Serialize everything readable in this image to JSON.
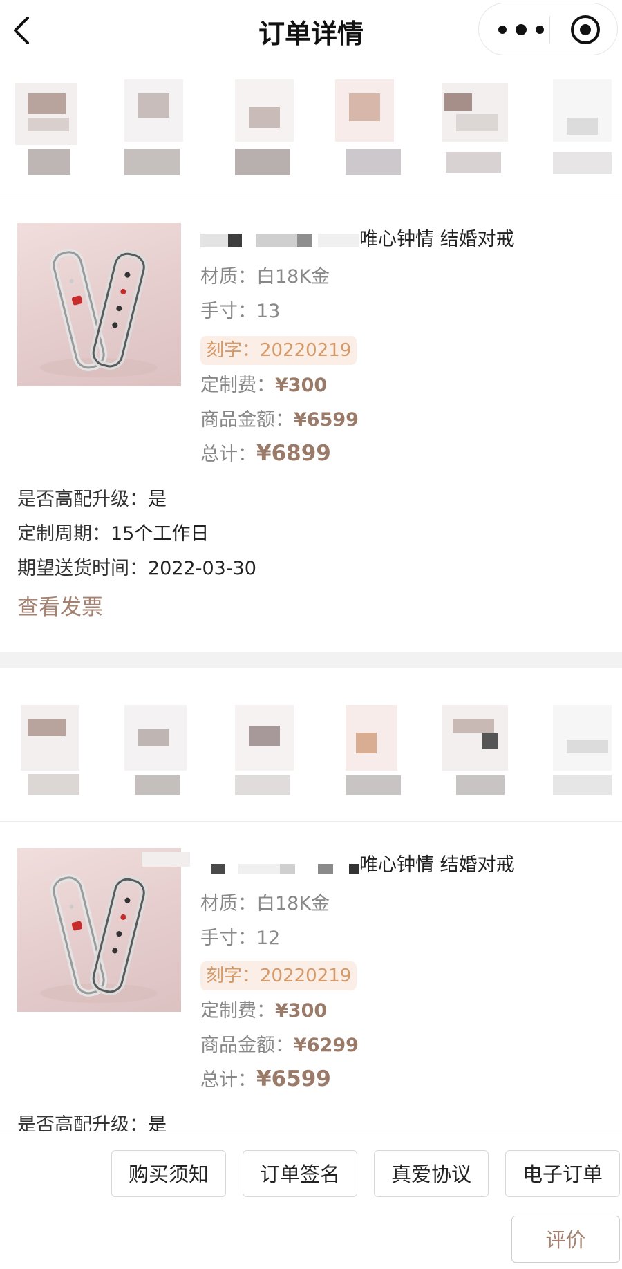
{
  "header": {
    "title": "订单详情"
  },
  "orders": [
    {
      "product_name": "唯心钟情 结婚对戒",
      "material_label": "材质：",
      "material": "白18K金",
      "size_label": "手寸：",
      "size": "13",
      "engrave_label": "刻字：",
      "engrave": "20220219",
      "custom_fee_label": "定制费：",
      "custom_fee": "¥300",
      "goods_amount_label": "商品金额：",
      "goods_amount": "¥6599",
      "total_label": "总计：",
      "total": "¥6899",
      "upgrade_label": "是否高配升级：",
      "upgrade": "是",
      "period_label": "定制周期：",
      "period": "15个工作日",
      "delivery_label": "期望送货时间：",
      "delivery": "2022-03-30",
      "invoice_link": "查看发票"
    },
    {
      "product_name": "唯心钟情 结婚对戒",
      "material_label": "材质：",
      "material": "白18K金",
      "size_label": "手寸：",
      "size": "12",
      "engrave_label": "刻字：",
      "engrave": "20220219",
      "custom_fee_label": "定制费：",
      "custom_fee": "¥300",
      "goods_amount_label": "商品金额：",
      "goods_amount": "¥6299",
      "total_label": "总计：",
      "total": "¥6599",
      "upgrade_label": "是否高配升级：",
      "upgrade": "是"
    }
  ],
  "bottom_bar": {
    "buttons": [
      "购买须知",
      "订单签名",
      "真爱协议",
      "电子订单"
    ],
    "review": "评价"
  },
  "colors": {
    "accent": "#a48170",
    "engrave_bg": "#fbeee6",
    "engrave_text": "#d59a6a"
  }
}
